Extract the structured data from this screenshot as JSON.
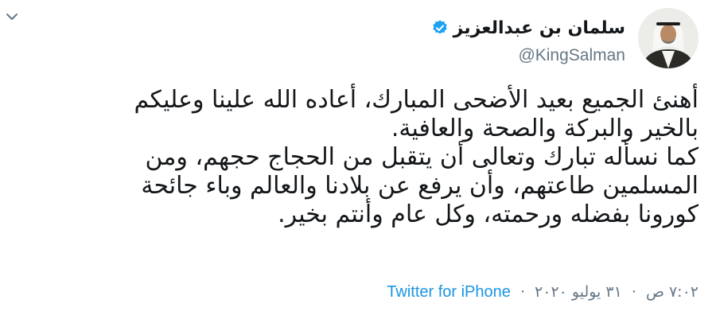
{
  "author": {
    "name": "سلمان بن عبدالعزيز",
    "handle": "@KingSalman",
    "verified": true,
    "avatar_icon": "portrait-avatar"
  },
  "tweet": {
    "lines": [
      "أهنئ الجميع بعيد الأضحى المبارك، أعاده الله علينا وعليكم",
      "بالخير والبركة والصحة والعافية.",
      "كما نسأله تبارك وتعالى أن يتقبل من الحجاج حجهم، ومن",
      "المسلمين طاعتهم، وأن يرفع عن بلادنا والعالم وباء جائحة",
      "كورونا بفضله ورحمته، وكل عام وأنتم بخير."
    ]
  },
  "meta": {
    "time": "٧:٠٢ ص",
    "separator": "·",
    "date": "٣١ يوليو ٢٠٢٠",
    "source": "Twitter for iPhone"
  },
  "colors": {
    "text": "#14171a",
    "secondary": "#657786",
    "link": "#1b95e0",
    "verified": "#1da1f2"
  },
  "icons": {
    "menu": "chevron-down-icon",
    "verified": "verified-badge-icon"
  }
}
